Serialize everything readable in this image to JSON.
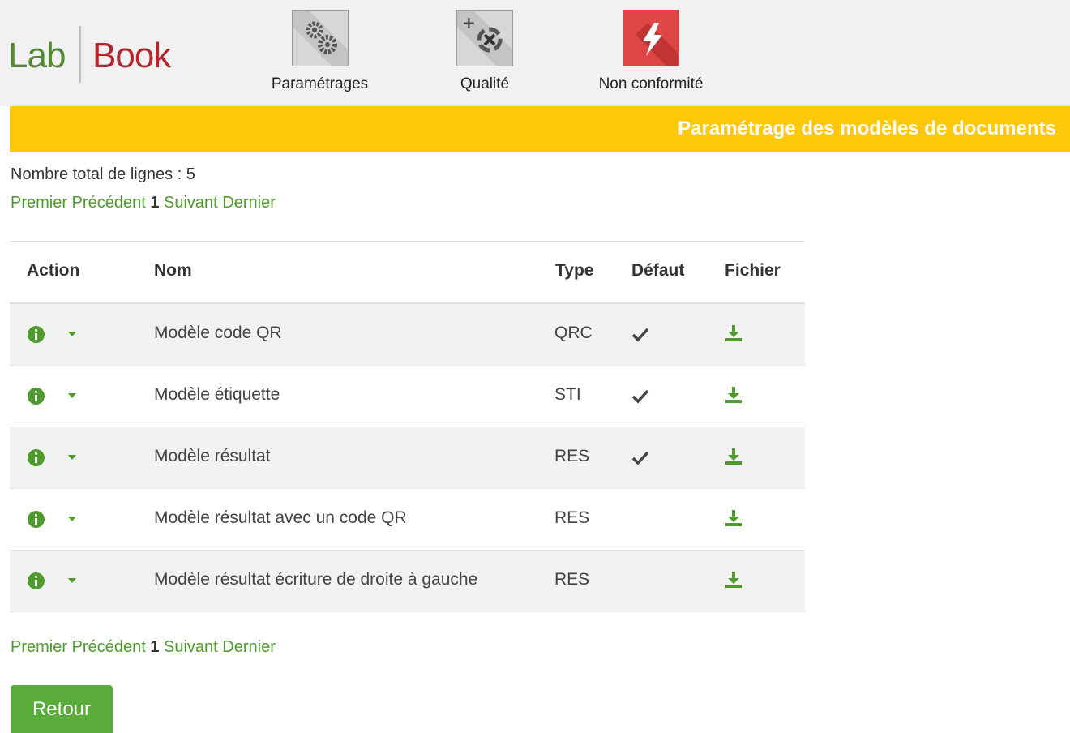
{
  "logo": {
    "part1": "Lab",
    "part2": "Book"
  },
  "nav": [
    {
      "label": "Paramétrages",
      "icon": "gears-icon"
    },
    {
      "label": "Qualité",
      "icon": "quality-target-icon"
    },
    {
      "label": "Non conformité",
      "icon": "lightning-icon"
    }
  ],
  "banner": {
    "title": "Paramétrage des modèles de documents"
  },
  "total": "Nombre total de lignes : 5",
  "pager": {
    "first": "Premier",
    "previous": "Précédent",
    "current": "1",
    "next": "Suivant",
    "last": "Dernier"
  },
  "table": {
    "headers": {
      "action": "Action",
      "nom": "Nom",
      "type": "Type",
      "defaut": "Défaut",
      "fichier": "Fichier"
    },
    "rows": [
      {
        "nom": "Modèle code QR",
        "type": "QRC",
        "defaut": true
      },
      {
        "nom": "Modèle étiquette",
        "type": "STI",
        "defaut": true
      },
      {
        "nom": "Modèle résultat",
        "type": "RES",
        "defaut": true
      },
      {
        "nom": "Modèle résultat avec un code QR",
        "type": "RES",
        "defaut": false
      },
      {
        "nom": "Modèle résultat écriture de droite à gauche",
        "type": "RES",
        "defaut": false
      }
    ]
  },
  "buttons": {
    "retour": "Retour"
  },
  "colors": {
    "accent_green": "#4e9a2c",
    "banner_yellow": "#fdc70a",
    "logo_red": "#b3262b",
    "button_green": "#5aac3a"
  }
}
